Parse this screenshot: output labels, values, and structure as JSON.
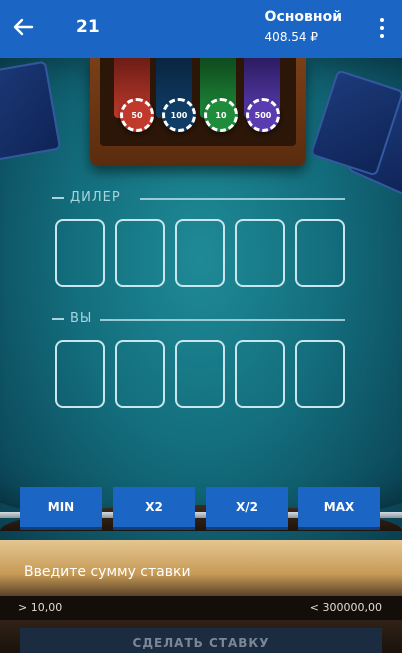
{
  "header": {
    "title": "21",
    "balance_label": "Основной",
    "balance_value": "408.54 ₽"
  },
  "table": {
    "chips": [
      "50",
      "100",
      "10",
      "500"
    ],
    "dealer_label": "ДИЛЕР",
    "player_label": "ВЫ"
  },
  "controls": {
    "min_label": "MIN",
    "x2_label": "X2",
    "half_label": "X/2",
    "max_label": "MAX"
  },
  "bet": {
    "placeholder": "Введите сумму ставки",
    "min_hint": "> 10,00",
    "max_hint": "< 300000,00",
    "submit_label": "СДЕЛАТЬ СТАВКУ"
  },
  "colors": {
    "primary": "#1b66c5",
    "felt": "#136e7d",
    "chip_50": "#c0392b",
    "chip_100": "#0f3d66",
    "chip_10": "#1e8c3a",
    "chip_500": "#5a3cb0"
  }
}
